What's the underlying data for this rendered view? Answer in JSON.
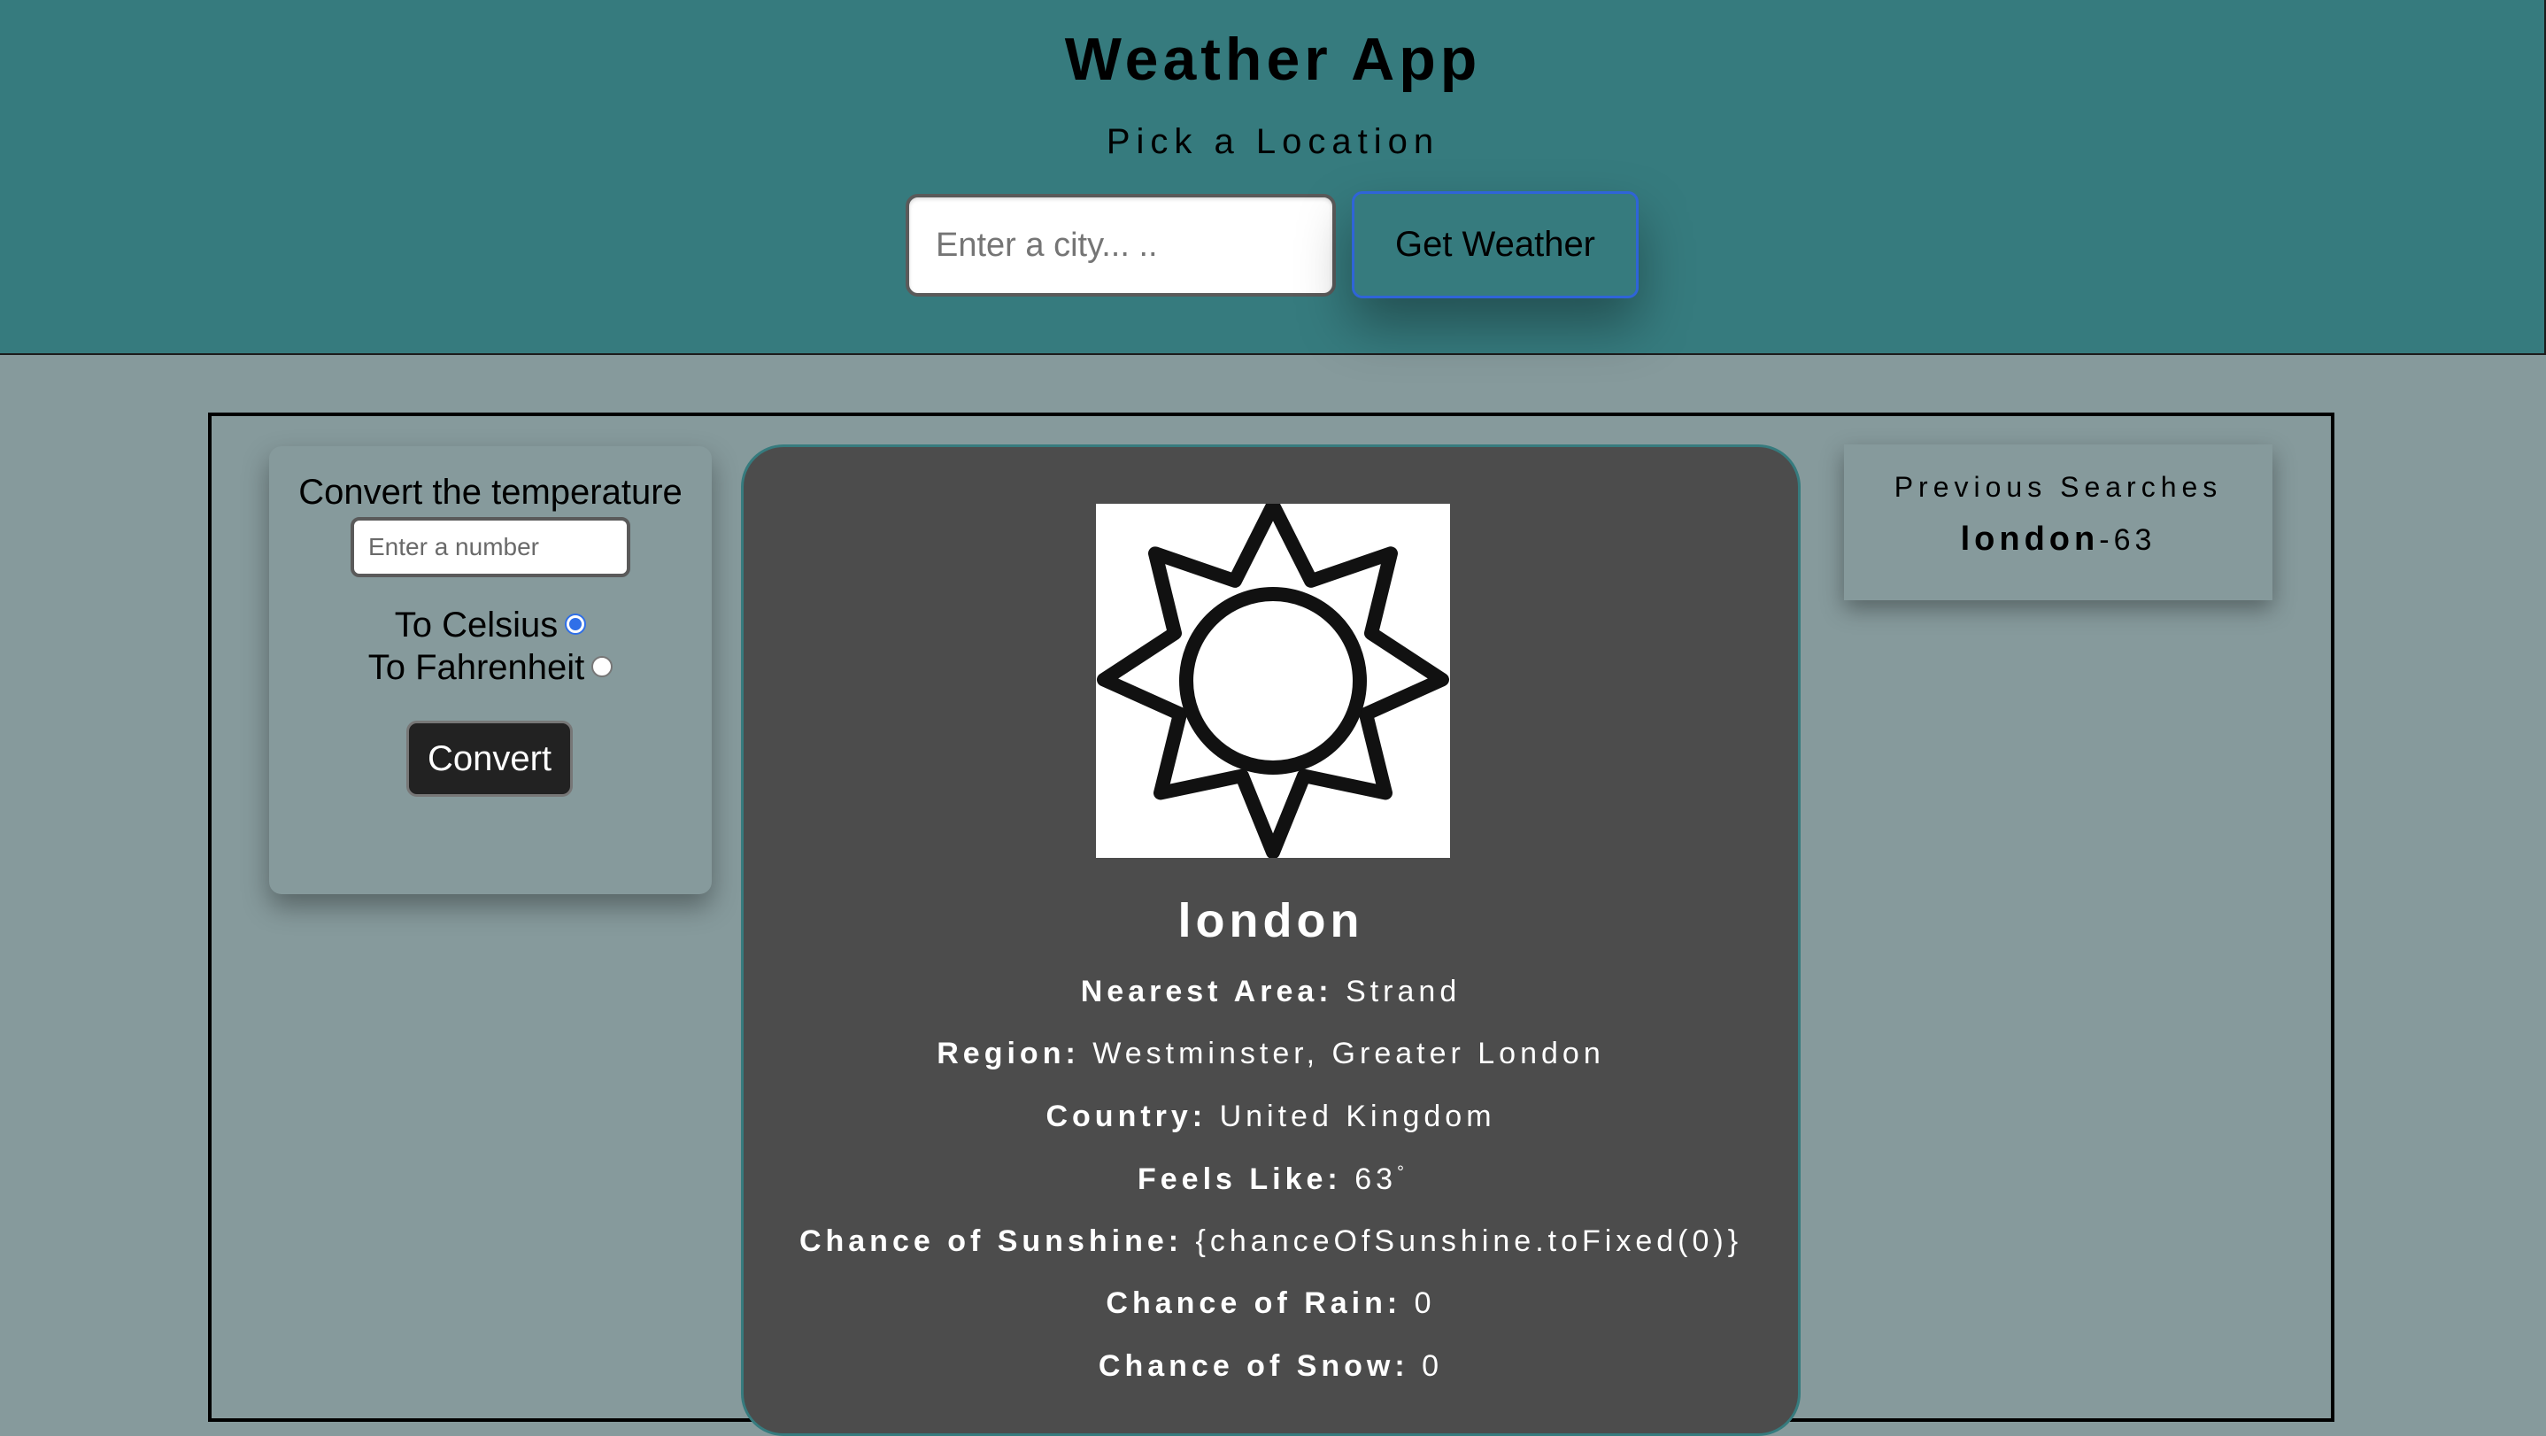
{
  "header": {
    "title": "Weather App",
    "subtitle": "Pick a Location",
    "city_placeholder": "Enter a city... ..",
    "get_weather_label": "Get Weather",
    "bg_color": "#367b7e"
  },
  "converter": {
    "title": "Convert the temperature",
    "number_placeholder": "Enter a number",
    "celsius_label": "To Celsius",
    "celsius_checked": true,
    "fahrenheit_label": "To Fahrenheit",
    "fahrenheit_checked": false,
    "convert_label": "Convert"
  },
  "weather": {
    "icon": "sun-icon",
    "location": "london",
    "nearest_area_label": "Nearest Area:",
    "nearest_area": "Strand",
    "region_label": "Region:",
    "region": "Westminster, Greater London",
    "country_label": "Country:",
    "country": "United Kingdom",
    "feels_like_label": "Feels Like:",
    "feels_like": "63",
    "degree_symbol": "°",
    "sunshine_label": "Chance of Sunshine:",
    "sunshine": "{chanceOfSunshine.toFixed(0)}",
    "rain_label": "Chance of Rain:",
    "rain": "0",
    "snow_label": "Chance of Snow:",
    "snow": "0"
  },
  "previous_searches": {
    "title": "Previous Searches",
    "items": [
      {
        "city": "london",
        "separator": "-",
        "temp": "63"
      }
    ]
  },
  "colors": {
    "page_bg": "#869a9c",
    "card_bg": "#4c4c4c",
    "accent_blue": "#2f6fe8"
  }
}
